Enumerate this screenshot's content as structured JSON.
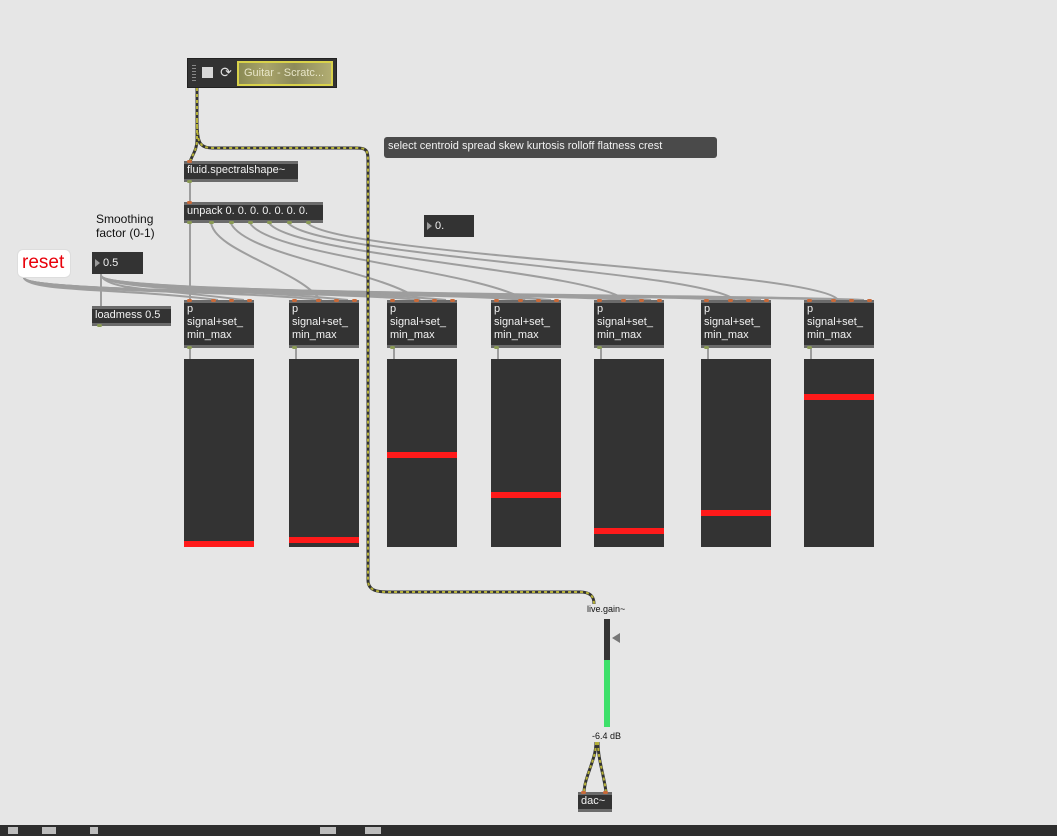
{
  "playlist": {
    "file_label": "Guitar - Scratc...",
    "stop_icon": "stop-icon",
    "loop_icon": "loop-icon"
  },
  "objects": {
    "spectral": "fluid.spectralshape~",
    "unpack": "unpack 0. 0. 0. 0. 0. 0. 0.",
    "loadmess": "loadmess 0.5",
    "subpatcher": "p\nsignal+set_\nmin_max",
    "dac": "dac~"
  },
  "message": "select centroid spread skew kurtosis rolloff flatness crest",
  "smoothing_comment": "Smoothing\nfactor (0-1)",
  "reset_label": "reset",
  "numbers": {
    "smoothing": "0.5",
    "float_out": "0."
  },
  "meters": [
    {
      "level": 0.0
    },
    {
      "level": 0.02
    },
    {
      "level": 0.49
    },
    {
      "level": 0.27
    },
    {
      "level": 0.07
    },
    {
      "level": 0.17
    },
    {
      "level": 0.81
    }
  ],
  "gain": {
    "title": "live.gain~",
    "readout": "-6.4 dB",
    "fraction": 0.62,
    "meter_color": "#3ee06a"
  },
  "colors": {
    "meter_fill": "#ff1a1a",
    "signal_patchcord": "#b7b23a",
    "reset": "#e8000a"
  }
}
